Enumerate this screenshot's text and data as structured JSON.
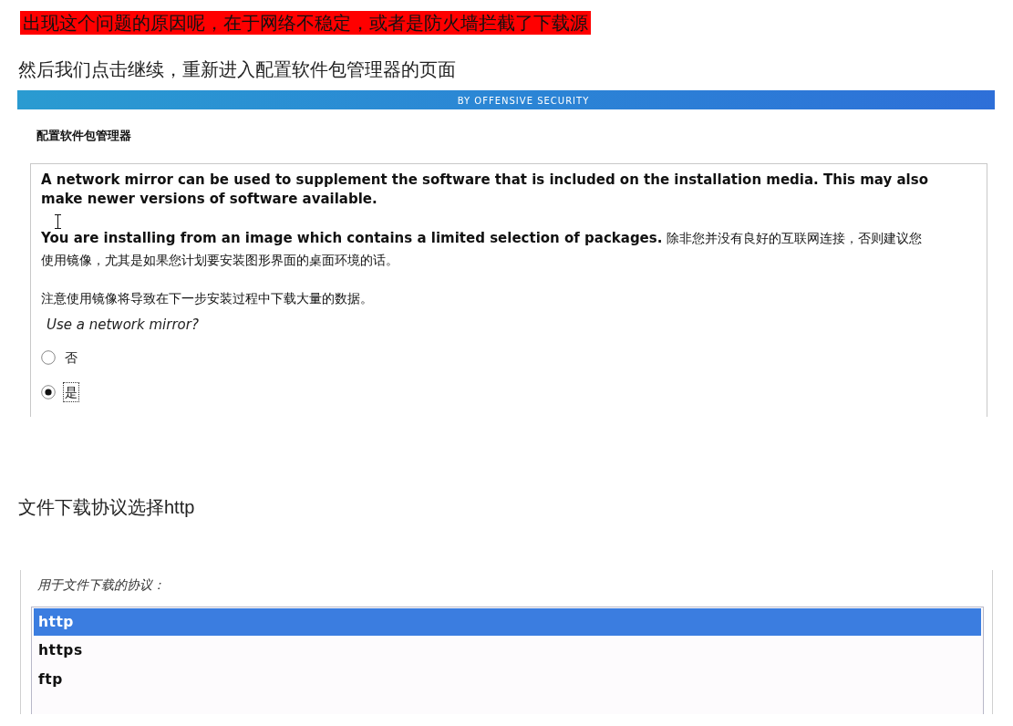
{
  "highlight_note": "出现这个问题的原因呢，在于网络不稳定，或者是防火墙拦截了下载源",
  "intro_text": "然后我们点击继续，重新进入配置软件包管理器的页面",
  "installer_screenshot": {
    "banner_text": "BY OFFENSIVE SECURITY",
    "title": "配置软件包管理器",
    "body": [
      {
        "kind": "bold",
        "text": "A network mirror can be used to supplement the software that is included on the installation media. This may also make newer versions of software available."
      },
      {
        "kind": "mixed",
        "text": "**You are installing from an image which contains a limited selection of packages.** 除非您并没有良好的互联网连接，否则建议您使用镜像，尤其是如果您计划要安装图形界面的桌面环境的话。"
      },
      {
        "kind": "plain",
        "text": "注意使用镜像将导致在下一步安装过程中下载大量的数据。"
      }
    ],
    "question": "Use a network mirror?",
    "options": [
      {
        "label": "否",
        "selected": false
      },
      {
        "label": "是",
        "selected": true
      }
    ]
  },
  "protocol_text": "文件下载协议选择http",
  "protocol_screenshot": {
    "label": "用于文件下载的协议：",
    "options": [
      {
        "label": "http",
        "selected": true
      },
      {
        "label": "https",
        "selected": false
      },
      {
        "label": "ftp",
        "selected": false
      }
    ]
  }
}
